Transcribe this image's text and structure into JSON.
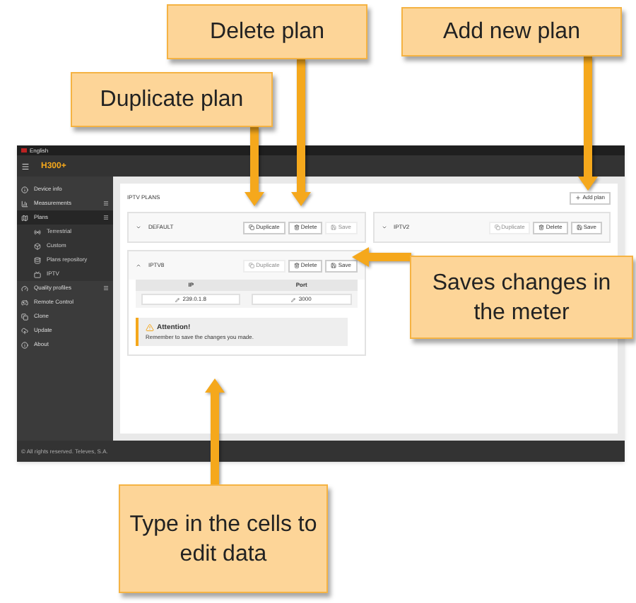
{
  "top_bar": {
    "language": "English"
  },
  "header": {
    "logo": "H300+"
  },
  "sidebar": {
    "items": [
      {
        "label": "Device info",
        "selected": false,
        "expandable": false
      },
      {
        "label": "Measurements",
        "selected": false,
        "expandable": true
      },
      {
        "label": "Plans",
        "selected": true,
        "expandable": true,
        "children": [
          {
            "label": "Terrestrial",
            "selected": false
          },
          {
            "label": "Custom",
            "selected": false
          },
          {
            "label": "Plans repository",
            "selected": false
          },
          {
            "label": "IPTV",
            "selected": false
          }
        ]
      },
      {
        "label": "Quality profiles",
        "selected": false,
        "expandable": true
      },
      {
        "label": "Remote Control",
        "selected": false,
        "expandable": false
      },
      {
        "label": "Clone",
        "selected": false,
        "expandable": false
      },
      {
        "label": "Update",
        "selected": false,
        "expandable": false
      },
      {
        "label": "About",
        "selected": false,
        "expandable": false
      }
    ]
  },
  "panel": {
    "title": "IPTV PLANS",
    "add_button": "Add plan"
  },
  "plans": [
    {
      "name": "DEFAULT",
      "expanded": false,
      "buttons": [
        {
          "label": "Duplicate",
          "kind": "duplicate",
          "disabled": false
        },
        {
          "label": "Delete",
          "kind": "delete",
          "disabled": false
        },
        {
          "label": "Save",
          "kind": "save",
          "disabled": true
        }
      ]
    },
    {
      "name": "IPTV2",
      "expanded": false,
      "buttons": [
        {
          "label": "Duplicate",
          "kind": "duplicate",
          "disabled": true
        },
        {
          "label": "Delete",
          "kind": "delete",
          "disabled": false
        },
        {
          "label": "Save",
          "kind": "save",
          "disabled": false
        }
      ]
    },
    {
      "name": "IPTV8",
      "expanded": true,
      "buttons": [
        {
          "label": "Duplicate",
          "kind": "duplicate",
          "disabled": true
        },
        {
          "label": "Delete",
          "kind": "delete",
          "disabled": false
        },
        {
          "label": "Save",
          "kind": "save",
          "disabled": false
        }
      ],
      "columns": [
        "IP",
        "Port"
      ],
      "cells": [
        "239.0.1.8",
        "3000"
      ],
      "alert": {
        "title": "Attention!",
        "text": "Remember to save the changes you made."
      }
    }
  ],
  "footer": "© All rights reserved. Televes, S.A.",
  "callouts": [
    {
      "text": "Delete plan"
    },
    {
      "text": "Add new plan"
    },
    {
      "text": "Duplicate plan"
    },
    {
      "text": "Saves changes in the meter"
    },
    {
      "text": "Type in the cells to edit data"
    }
  ]
}
